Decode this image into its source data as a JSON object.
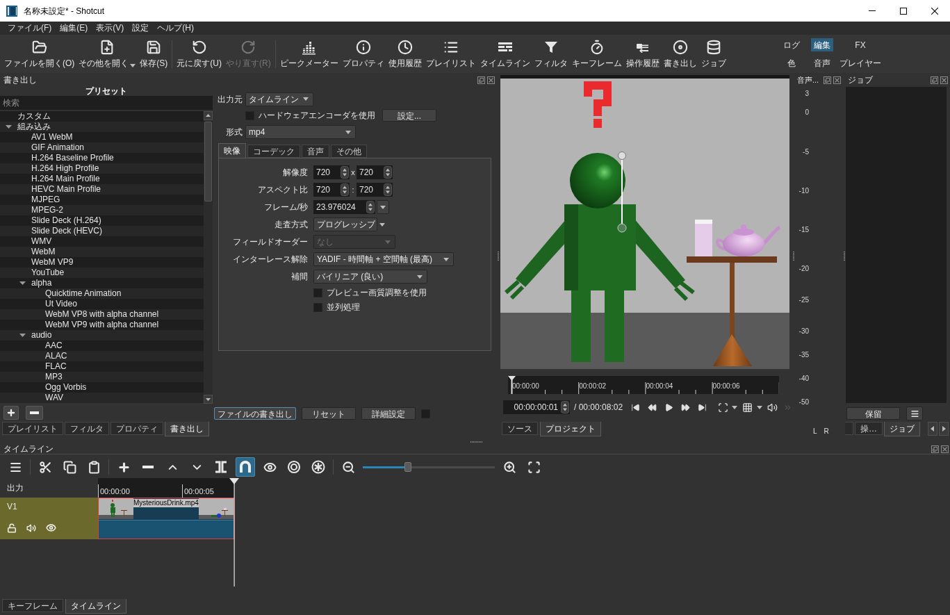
{
  "window": {
    "title": "名称未設定* - Shotcut"
  },
  "menu": [
    "ファイル(F)",
    "編集(E)",
    "表示(V)",
    "設定",
    "ヘルプ(H)"
  ],
  "toolbar": {
    "groups": [
      [
        {
          "label": "ファイルを開く(O)",
          "kind": "button",
          "disabled": false
        },
        {
          "label": "その他を開く",
          "kind": "menu",
          "disabled": false
        },
        {
          "label": "保存(S)",
          "kind": "button",
          "disabled": false
        }
      ],
      [
        {
          "label": "元に戻す(U)",
          "kind": "button",
          "disabled": false
        },
        {
          "label": "やり直す(R)",
          "kind": "button",
          "disabled": true
        }
      ],
      [
        {
          "label": "ピークメーター",
          "kind": "button",
          "disabled": false
        },
        {
          "label": "プロパティ",
          "kind": "button",
          "disabled": false
        },
        {
          "label": "使用履歴",
          "kind": "button",
          "disabled": false
        },
        {
          "label": "プレイリスト",
          "kind": "button",
          "disabled": false
        },
        {
          "label": "タイムライン",
          "kind": "button",
          "disabled": false
        },
        {
          "label": "フィルタ",
          "kind": "button",
          "disabled": false
        },
        {
          "label": "キーフレーム",
          "kind": "button",
          "disabled": false
        },
        {
          "label": "操作履歴",
          "kind": "button",
          "disabled": false
        },
        {
          "label": "書き出し",
          "kind": "button",
          "disabled": false
        },
        {
          "label": "ジョブ",
          "kind": "button",
          "disabled": false
        }
      ]
    ],
    "layouts": [
      {
        "label": "ログ",
        "selected": false
      },
      {
        "label": "編集",
        "selected": true
      },
      {
        "label": "FX",
        "selected": false
      },
      {
        "label": "色",
        "selected": false
      },
      {
        "label": "音声",
        "selected": false
      },
      {
        "label": "プレイヤー",
        "selected": false
      }
    ]
  },
  "export": {
    "title": "書き出し",
    "presets": {
      "header": "プリセット",
      "search": {
        "placeholder": "検索"
      },
      "items": [
        {
          "label": "カスタム"
        },
        {
          "label": "組み込み",
          "expanded": true,
          "children": [
            {
              "label": "AV1 WebM"
            },
            {
              "label": "GIF Animation"
            },
            {
              "label": "H.264 Baseline Profile"
            },
            {
              "label": "H.264 High Profile"
            },
            {
              "label": "H.264 Main Profile"
            },
            {
              "label": "HEVC Main Profile"
            },
            {
              "label": "MJPEG"
            },
            {
              "label": "MPEG-2"
            },
            {
              "label": "Slide Deck (H.264)"
            },
            {
              "label": "Slide Deck (HEVC)"
            },
            {
              "label": "WMV"
            },
            {
              "label": "WebM"
            },
            {
              "label": "WebM VP9"
            },
            {
              "label": "YouTube"
            },
            {
              "label": "alpha",
              "expanded": true,
              "children": [
                {
                  "label": "Quicktime Animation"
                },
                {
                  "label": "Ut Video"
                },
                {
                  "label": "WebM VP8 with alpha channel"
                },
                {
                  "label": "WebM VP9 with alpha channel"
                }
              ]
            },
            {
              "label": "audio",
              "expanded": true,
              "children": [
                {
                  "label": "AAC"
                },
                {
                  "label": "ALAC"
                },
                {
                  "label": "FLAC"
                },
                {
                  "label": "MP3"
                },
                {
                  "label": "Ogg Vorbis"
                },
                {
                  "label": "WAV"
                }
              ]
            }
          ]
        }
      ]
    },
    "source": {
      "label": "出力元",
      "value": "タイムライン"
    },
    "hardware_encoder": {
      "label": "ハードウェアエンコーダを使用",
      "checked": false
    },
    "configure_button": "設定...",
    "format": {
      "label": "形式",
      "value": "mp4"
    },
    "tabs": [
      {
        "label": "映像",
        "selected": true
      },
      {
        "label": "コーデック",
        "selected": false
      },
      {
        "label": "音声",
        "selected": false
      },
      {
        "label": "その他",
        "selected": false
      }
    ],
    "video": [
      {
        "kind": "spin_pair",
        "label": "解像度",
        "values": [
          "720",
          "720"
        ],
        "separator": "x"
      },
      {
        "kind": "spin_pair",
        "label": "アスペクト比",
        "values": [
          "720",
          "720"
        ],
        "separator": ":"
      },
      {
        "kind": "spin_menu",
        "label": "フレーム/秒",
        "value": "23.976024"
      },
      {
        "kind": "combo",
        "label": "走査方式",
        "value": "プログレッシブ",
        "disabled": false
      },
      {
        "kind": "combo",
        "label": "フィールドオーダー",
        "value": "なし",
        "disabled": true
      },
      {
        "kind": "combo",
        "label": "インターレース解除",
        "value": "YADIF - 時間軸 + 空間軸 (最高)",
        "disabled": false
      },
      {
        "kind": "combo",
        "label": "補間",
        "value": "バイリニア (良い)",
        "disabled": false
      },
      {
        "kind": "checkbox",
        "label": "プレビュー画質調整を使用",
        "checked": false
      },
      {
        "kind": "checkbox",
        "label": "並列処理",
        "checked": false
      }
    ],
    "actions": [
      {
        "label": "ファイルの書き出し",
        "focused": true
      },
      {
        "label": "リセット",
        "focused": false
      },
      {
        "label": "詳細設定",
        "focused": false
      }
    ],
    "extra_checkbox": {
      "checked": false
    }
  },
  "left_tabs": [
    {
      "label": "プレイリスト",
      "selected": false
    },
    {
      "label": "フィルタ",
      "selected": false
    },
    {
      "label": "プロパティ",
      "selected": false
    },
    {
      "label": "書き出し",
      "selected": true
    }
  ],
  "player": {
    "ruler": [
      "00:00:00",
      "00:00:02",
      "00:00:04",
      "00:00:06"
    ],
    "position": "00:00:00:01",
    "duration": "/ 00:00:08:02",
    "tabs": [
      {
        "label": "ソース",
        "selected": false
      },
      {
        "label": "プロジェクト",
        "selected": true
      }
    ]
  },
  "audio_meter": {
    "title": "音声...",
    "scale": [
      "3",
      "0",
      "-5",
      "-10",
      "-15",
      "-20",
      "-25",
      "-30",
      "-35",
      "-40",
      "-50"
    ],
    "channels": [
      "L",
      "R"
    ]
  },
  "jobs": {
    "title": "ジョブ",
    "hold_button": "保留",
    "tabs": [
      {
        "label": "操…",
        "selected": false
      },
      {
        "label": "ジョブ",
        "selected": true
      }
    ]
  },
  "timeline": {
    "title": "タイムライン",
    "toggles": [
      {
        "on": true
      },
      {
        "on": false
      },
      {
        "on": false
      },
      {
        "on": false
      }
    ],
    "zoom": {
      "level": 0.34
    },
    "output_label": "出力",
    "ruler": [
      "00:00:00",
      "00:00:05"
    ],
    "tracks": [
      {
        "name": "V1",
        "locked": false,
        "muted": false,
        "hidden": false,
        "clips": [
          {
            "name": "MysteriousDrink.mp4",
            "selected": true
          }
        ]
      }
    ]
  },
  "bottom_tabs": [
    {
      "label": "キーフレーム",
      "selected": false
    },
    {
      "label": "タイムライン",
      "selected": true
    }
  ]
}
